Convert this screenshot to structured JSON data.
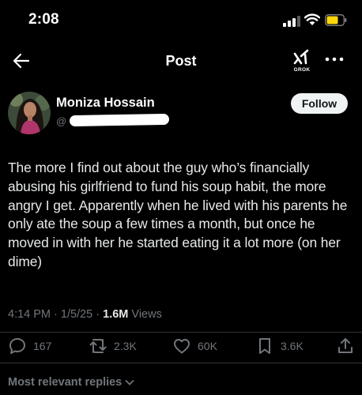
{
  "status_bar": {
    "time": "2:08"
  },
  "header": {
    "title": "Post",
    "grok_label": "GROK"
  },
  "author": {
    "name": "Moniza Hossain",
    "handle_prefix": "@"
  },
  "follow_label": "Follow",
  "post": {
    "text": "The more I find out about the guy who’s financially abusing his girlfriend to fund his soup habit, the more angry I get. Apparently when he lived with his parents he only ate the soup a few times a month, but once he moved in with her he started eating it a lot more (on her dime)",
    "time": "4:14 PM",
    "date": "1/5/25",
    "sep": "·",
    "views_count": "1.6M",
    "views_label": "Views"
  },
  "actions": {
    "replies": "167",
    "reposts": "2.3K",
    "likes": "60K",
    "bookmarks": "3.6K"
  },
  "replies_sort_label": "Most relevant replies",
  "colors": {
    "background": "#000000",
    "text": "#e7e9ea",
    "muted": "#71767b",
    "divider": "#2f3336",
    "battery": "#ffd60a"
  },
  "icons": [
    "signal-icon",
    "wifi-icon",
    "battery-icon",
    "back-arrow-icon",
    "grok-icon",
    "more-icon",
    "reply-icon",
    "repost-icon",
    "like-icon",
    "bookmark-icon",
    "share-icon",
    "chevron-down-icon"
  ]
}
